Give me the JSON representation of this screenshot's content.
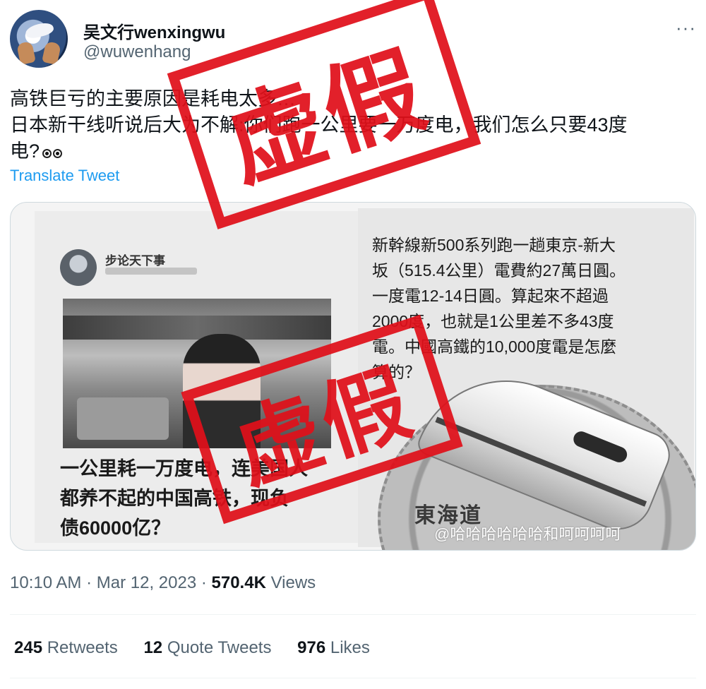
{
  "author": {
    "display_name": "吴文行wenxingwu",
    "handle": "@wuwenhang"
  },
  "more_label": "···",
  "tweet": {
    "line1": "高铁巨亏的主要原因是耗电太多…",
    "line2": "日本新干线听说后大为不解:你们跑一公里要一万度电，我们怎么只要43度",
    "line3": "电?",
    "translate_label": "Translate Tweet"
  },
  "media": {
    "left_image": {
      "author": "步论天下事",
      "headline": [
        "一公里耗一万度电，连美国人",
        "都养不起的中国高铁，现负",
        "债60000亿？"
      ]
    },
    "right_image": {
      "lines": [
        "新幹線新500系列跑一趟東京-新大",
        "坂（515.4公里）電費約27萬日圓。",
        "一度電12-14日圓。算起來不超過",
        "2000度，也就是1公里差不多43度",
        "電。中國高鐵的10,000度電是怎麼",
        "算的？"
      ],
      "coin_label": "東海道",
      "watermark": "@哈哈哈哈哈哈和呵呵呵呵"
    },
    "stamp_text": "虚假",
    "stamp_color": "#e0101a"
  },
  "meta": {
    "time": "10:10 AM",
    "separator": "·",
    "date": "Mar 12, 2023",
    "views_count": "570.4K",
    "views_label": "Views"
  },
  "stats": {
    "retweets_count": "245",
    "retweets_label": "Retweets",
    "quotes_count": "12",
    "quotes_label": "Quote Tweets",
    "likes_count": "976",
    "likes_label": "Likes"
  },
  "colors": {
    "link": "#1d9bf0",
    "secondary_text": "#536471",
    "primary_text": "#0f1419"
  }
}
